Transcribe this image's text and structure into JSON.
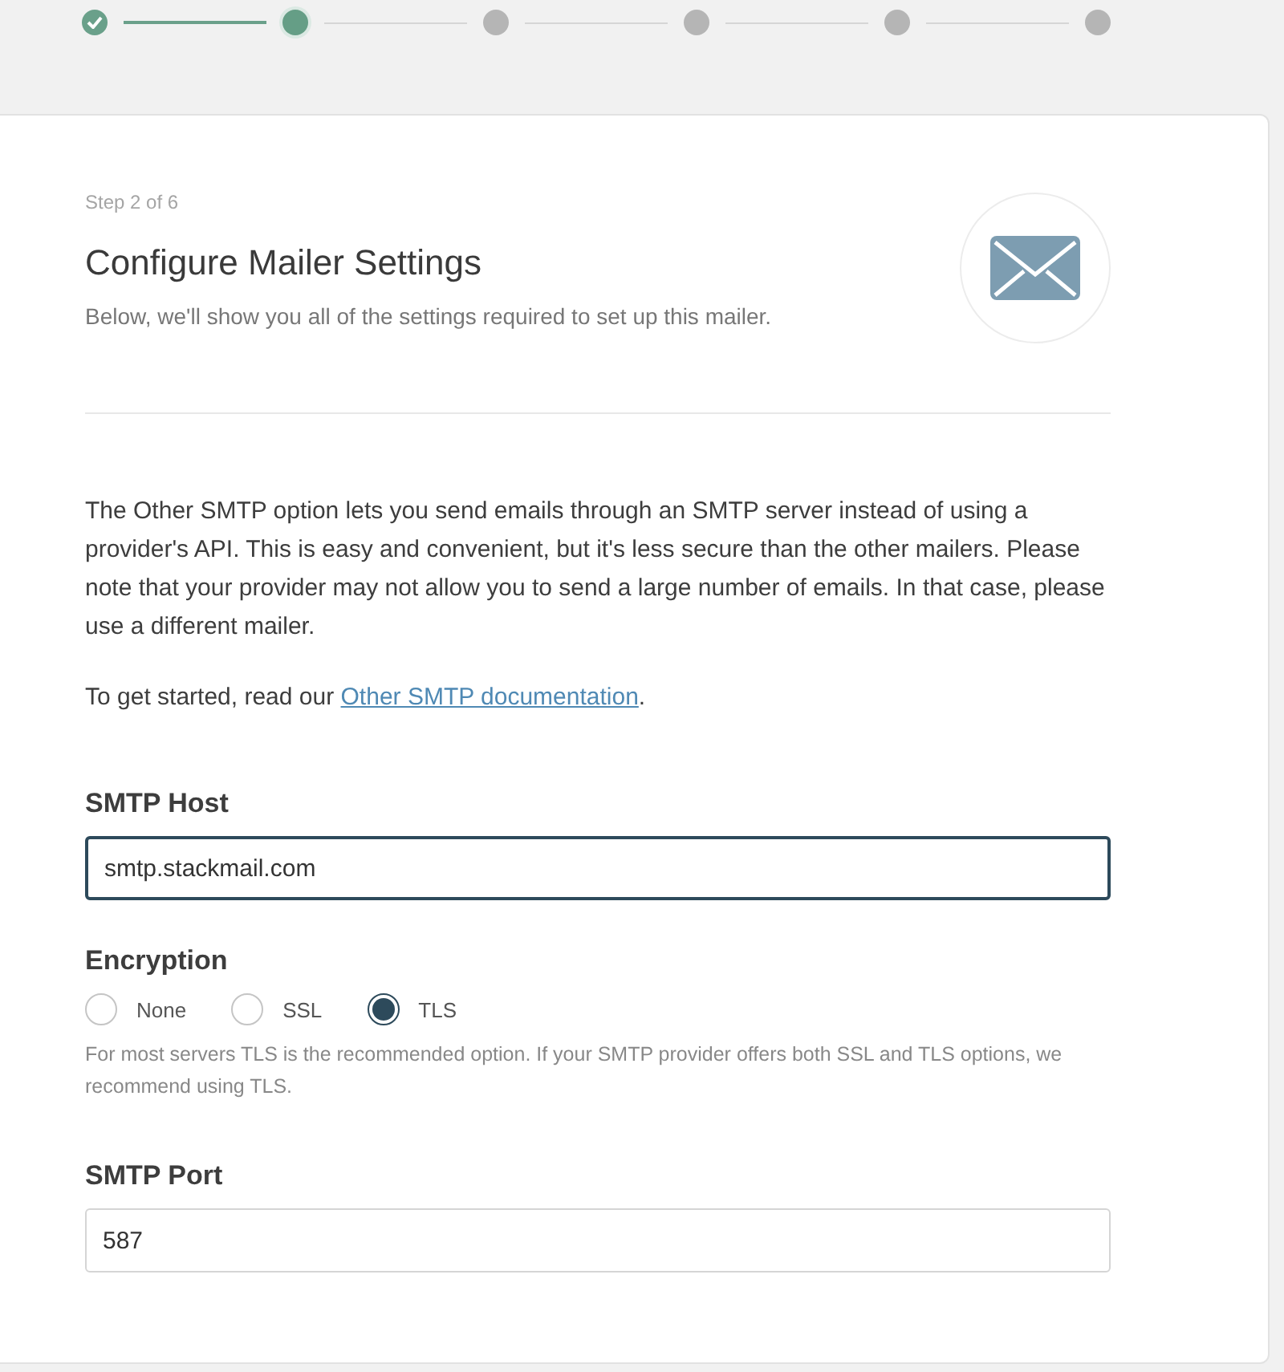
{
  "steps": [
    {
      "completed": true,
      "selected": false
    },
    {
      "completed": false,
      "selected": true
    },
    {
      "completed": false,
      "selected": false
    },
    {
      "completed": false,
      "selected": false
    },
    {
      "completed": false,
      "selected": false
    },
    {
      "completed": false,
      "selected": false
    }
  ],
  "header": {
    "step_label": "Step 2 of 6",
    "title": "Configure Mailer Settings",
    "subtitle": "Below, we'll show you all of the settings required to set up this mailer."
  },
  "description": "The Other SMTP option lets you send emails through an SMTP server instead of using a provider's API. This is easy and convenient, but it's less secure than the other mailers. Please note that your provider may not allow you to send a large number of emails. In that case, please use a different mailer.",
  "getting_started": {
    "before": "To get started, read our ",
    "link": "Other SMTP documentation",
    "after": "."
  },
  "smtp_host": {
    "label": "SMTP Host",
    "value": "smtp.stackmail.com",
    "focused": true
  },
  "encryption": {
    "label": "Encryption",
    "options": [
      {
        "label": "None",
        "selected": false
      },
      {
        "label": "SSL",
        "selected": false
      },
      {
        "label": "TLS",
        "selected": true
      }
    ],
    "help": "For most servers TLS is the recommended option. If your SMTP provider offers both SSL and TLS options, we recommend using TLS."
  },
  "smtp_port": {
    "label": "SMTP Port",
    "value": "587",
    "focused": false
  }
}
